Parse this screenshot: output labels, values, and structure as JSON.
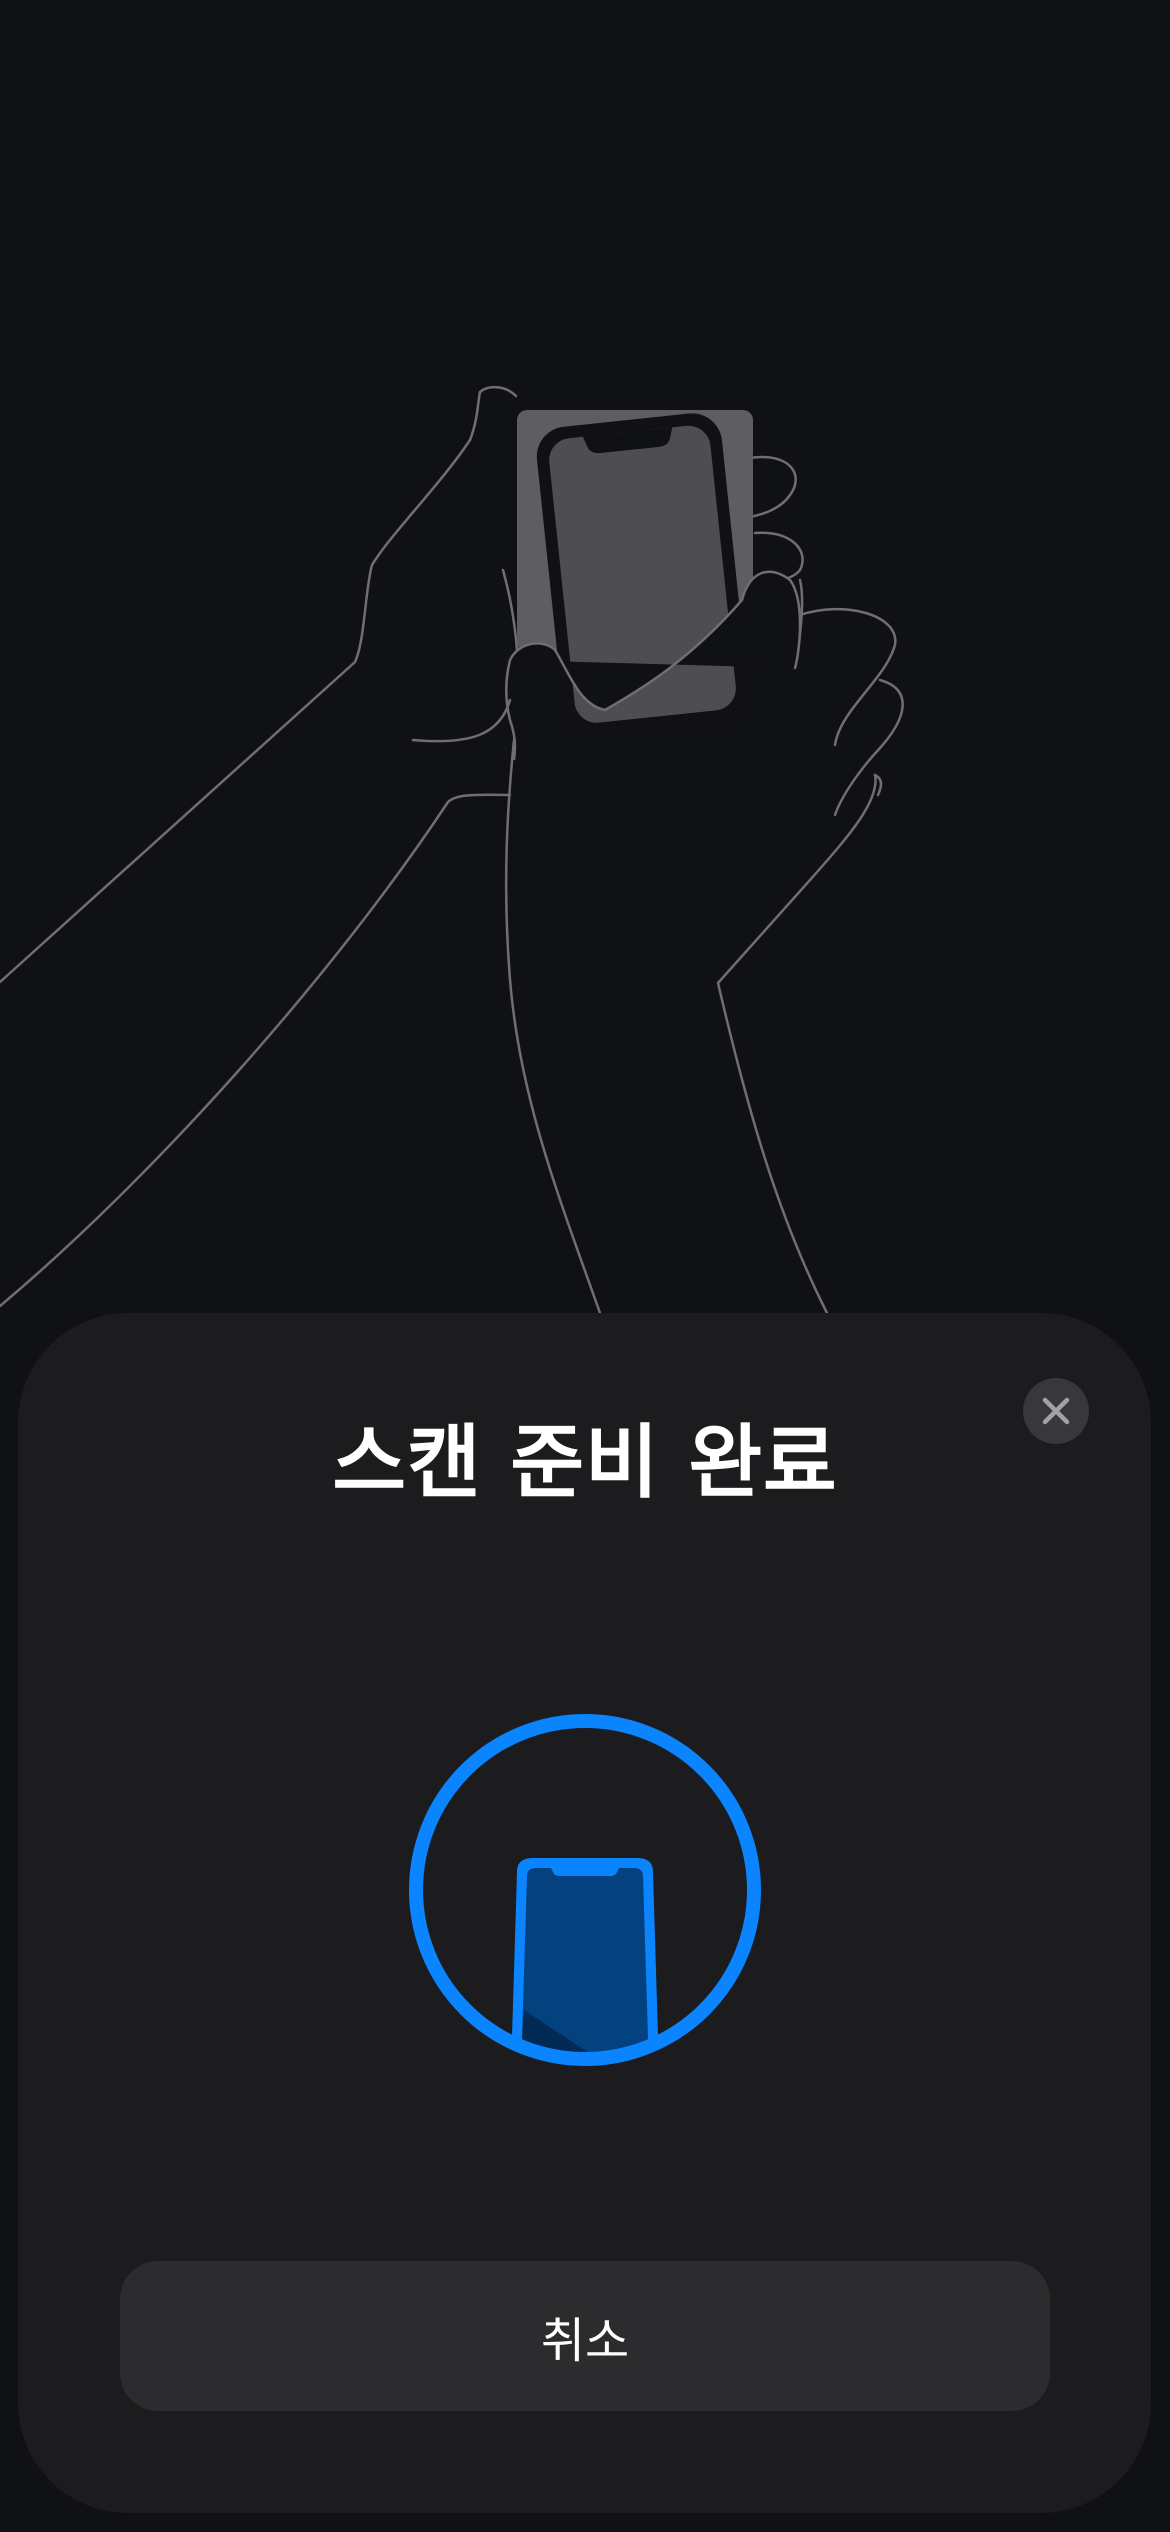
{
  "sheet": {
    "title": "스캔 준비 완료",
    "cancel_label": "취소"
  },
  "icons": {
    "close": "close-icon",
    "illustration": "hand-holding-phone-illustration",
    "scan": "phone-scan-icon"
  },
  "colors": {
    "background": "#101115",
    "sheet": "#1c1c1e",
    "accent": "#0a84ff",
    "button": "#2c2c2e"
  }
}
